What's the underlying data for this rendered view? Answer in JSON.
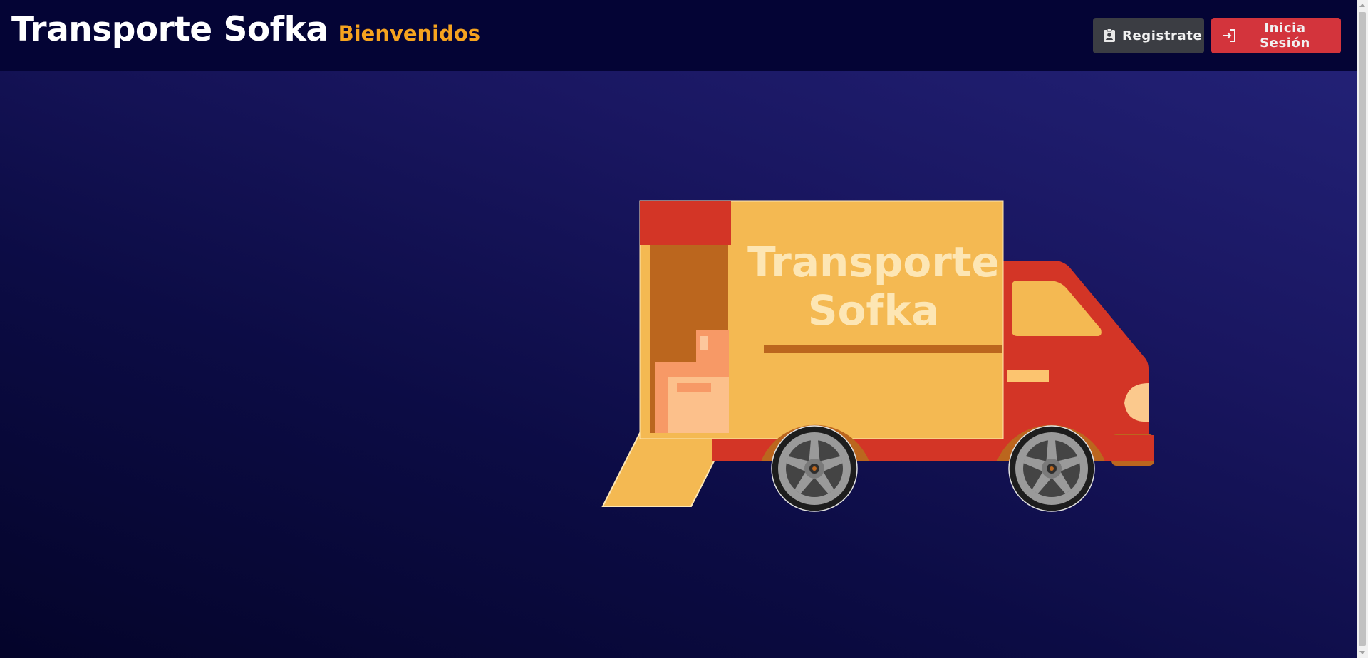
{
  "header": {
    "title": "Transporte Sofka",
    "subtitle": "Bienvenidos"
  },
  "actions": {
    "register_label": "Registrate",
    "login_label": "Inicia Sesión",
    "register_icon": "id-badge-icon",
    "login_icon": "login-arrow-icon"
  },
  "hero": {
    "truck_text_line1": "Transporte",
    "truck_text_line2": "Sofka"
  },
  "colors": {
    "brand_accent": "#f5a31f",
    "navbar_bg": "#040435",
    "register_btn": "#3b3d43",
    "login_btn": "#d3343c",
    "truck_box": "#f4b952",
    "truck_cab": "#d33526",
    "truck_text": "#fde6b4"
  }
}
